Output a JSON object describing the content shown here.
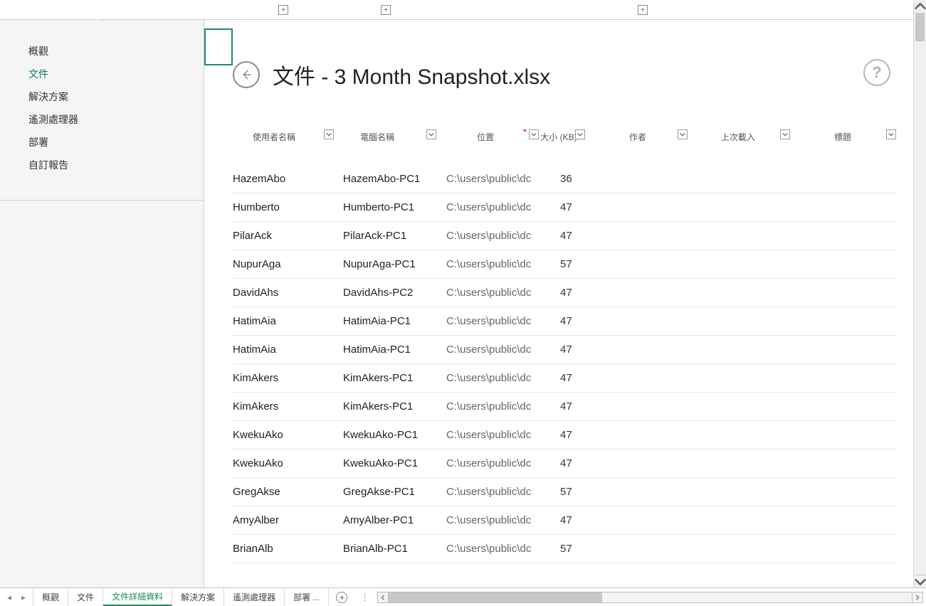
{
  "plus_positions": [
    391,
    535,
    896
  ],
  "sidebar": {
    "items": [
      {
        "label": "概觀"
      },
      {
        "label": "文件"
      },
      {
        "label": "解決方案"
      },
      {
        "label": "遙測處理器"
      },
      {
        "label": "部署"
      },
      {
        "label": "自訂報告"
      }
    ],
    "active_index": 1
  },
  "header": {
    "title": "文件 - 3 Month Snapshot.xlsx",
    "help_glyph": "?"
  },
  "columns": [
    {
      "label": "使用者名稱"
    },
    {
      "label": "電腦名稱"
    },
    {
      "label": "位置",
      "sorted": true
    },
    {
      "label": "大小 (KB)"
    },
    {
      "label": "作者"
    },
    {
      "label": "上次載入"
    },
    {
      "label": "標題"
    }
  ],
  "rows": [
    {
      "user": "HazemAbo",
      "pc": "HazemAbo-PC1",
      "path": "C:\\users\\public\\dc",
      "size": "36"
    },
    {
      "user": "Humberto",
      "pc": "Humberto-PC1",
      "path": "C:\\users\\public\\dc",
      "size": "47"
    },
    {
      "user": "PilarAck",
      "pc": "PilarAck-PC1",
      "path": "C:\\users\\public\\dc",
      "size": "47"
    },
    {
      "user": "NupurAga",
      "pc": "NupurAga-PC1",
      "path": "C:\\users\\public\\dc",
      "size": "57"
    },
    {
      "user": "DavidAhs",
      "pc": "DavidAhs-PC2",
      "path": "C:\\users\\public\\dc",
      "size": "47"
    },
    {
      "user": "HatimAia",
      "pc": "HatimAia-PC1",
      "path": "C:\\users\\public\\dc",
      "size": "47"
    },
    {
      "user": "HatimAia",
      "pc": "HatimAia-PC1",
      "path": "C:\\users\\public\\dc",
      "size": "47"
    },
    {
      "user": "KimAkers",
      "pc": "KimAkers-PC1",
      "path": "C:\\users\\public\\dc",
      "size": "47"
    },
    {
      "user": "KimAkers",
      "pc": "KimAkers-PC1",
      "path": "C:\\users\\public\\dc",
      "size": "47"
    },
    {
      "user": "KwekuAko",
      "pc": "KwekuAko-PC1",
      "path": "C:\\users\\public\\dc",
      "size": "47"
    },
    {
      "user": "KwekuAko",
      "pc": "KwekuAko-PC1",
      "path": "C:\\users\\public\\dc",
      "size": "47"
    },
    {
      "user": "GregAkse",
      "pc": "GregAkse-PC1",
      "path": "C:\\users\\public\\dc",
      "size": "57"
    },
    {
      "user": "AmyAlber",
      "pc": "AmyAlber-PC1",
      "path": "C:\\users\\public\\dc",
      "size": "47"
    },
    {
      "user": "BrianAlb",
      "pc": "BrianAlb-PC1",
      "path": "C:\\users\\public\\dc",
      "size": "57"
    }
  ],
  "bottom_tabs": {
    "items": [
      {
        "label": "概觀"
      },
      {
        "label": "文件"
      },
      {
        "label": "文件詳細資料"
      },
      {
        "label": "解決方案"
      },
      {
        "label": "遙測處理器"
      },
      {
        "label": "部署 ..."
      }
    ],
    "active_index": 2,
    "ellipsis": "⋮",
    "nav_prev": "◂",
    "nav_next": "▸"
  }
}
